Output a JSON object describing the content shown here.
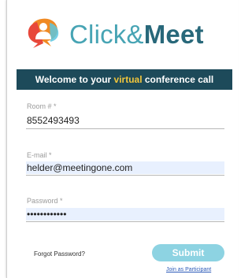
{
  "brand": {
    "name_part1": "Click&",
    "name_part2": "Meet",
    "logo_icon": "person-chat-bubbles-icon",
    "colors": {
      "teal": "#47a4b4",
      "dark_teal": "#28687a",
      "orange": "#f08a24",
      "red": "#e8483b",
      "light_blue": "#5cc7e0"
    }
  },
  "welcome": {
    "text_before": "Welcome to your ",
    "highlight": "virtual",
    "text_after": " conference call",
    "bar_color": "#1d4a5a",
    "highlight_color": "#f0c53c"
  },
  "form": {
    "room": {
      "label": "Room # *",
      "value": "8552493493"
    },
    "email": {
      "label": "E-mail *",
      "value": "helder@meetingone.com"
    },
    "password": {
      "label": "Password *",
      "value": "••••••••••••"
    }
  },
  "actions": {
    "forgot_label": "Forgot Password?",
    "submit_label": "Submit",
    "join_label": "Join as Participant",
    "submit_color": "#8dd3e2"
  }
}
